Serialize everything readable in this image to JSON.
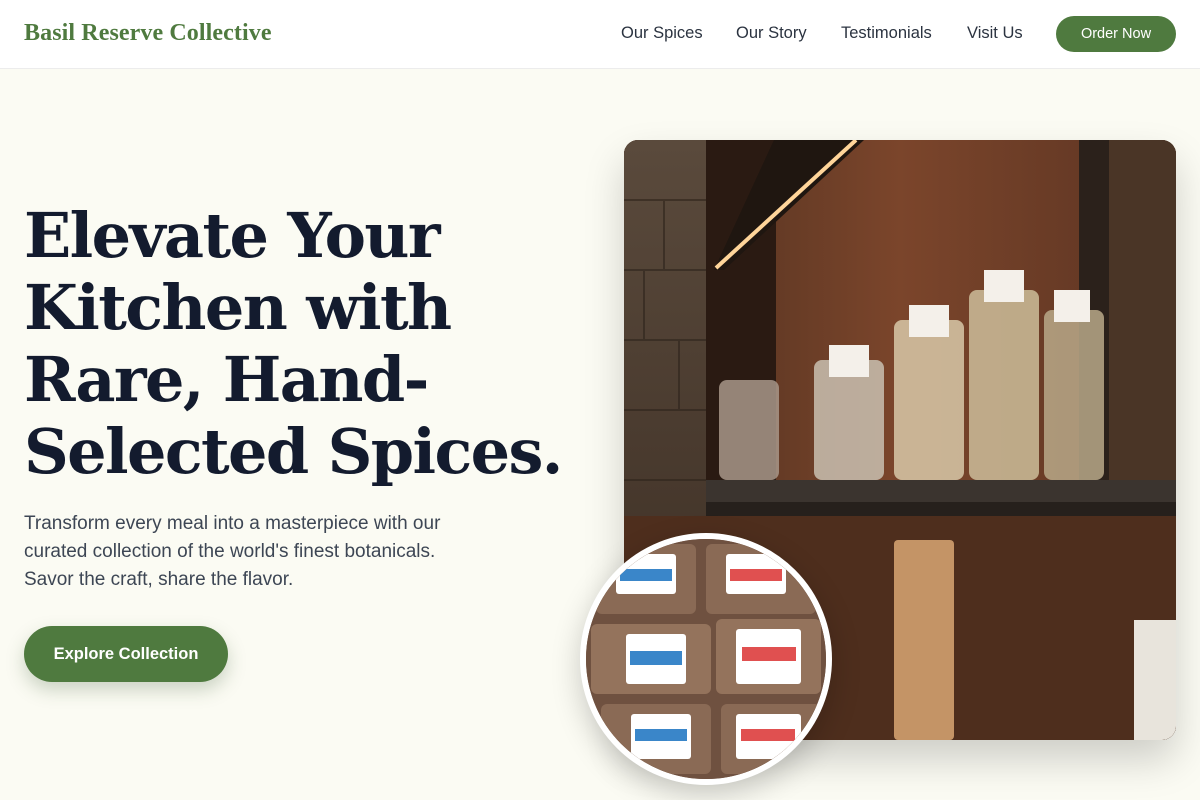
{
  "header": {
    "brand": "Basil Reserve Collective",
    "nav": [
      "Our Spices",
      "Our Story",
      "Testimonials",
      "Visit Us"
    ],
    "cta": "Order Now"
  },
  "hero": {
    "title_lines": [
      "Elevate Your",
      "Kitchen with",
      "Rare, Hand-",
      "Selected Spices."
    ],
    "subtitle_lines": [
      "Transform every meal into a masterpiece with our",
      "curated collection of the world's finest botanicals.",
      "Savor the craft, share the flavor."
    ],
    "cta": "Explore Collection"
  },
  "colors": {
    "accent": "#4f7a3f",
    "ink": "#131b2e",
    "background": "#fbfbf3"
  }
}
